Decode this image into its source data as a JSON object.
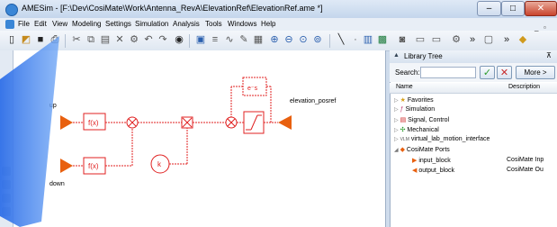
{
  "window": {
    "title": "AMESim - [F:\\Dev\\CosiMate\\Work\\Antenna_RevA\\ElevationRef\\ElevationRef.ame *]",
    "minimize": "–",
    "maximize": "□",
    "close": "✕"
  },
  "menu": {
    "items": [
      "File",
      "Edit",
      "View",
      "Modeling",
      "Settings",
      "Simulation",
      "Analysis",
      "Tools",
      "Windows",
      "Help"
    ]
  },
  "toolbar": {
    "icons": [
      "new-icon",
      "open-icon",
      "save-icon",
      "print-icon",
      "cut-icon",
      "copy-icon",
      "paste-icon",
      "delete-icon",
      "undo-icon",
      "redo-icon",
      "find-icon",
      "zoom-in-icon",
      "zoom-out-icon",
      "zoom-fit-icon",
      "line-icon",
      "grid-icon",
      "more-icon"
    ]
  },
  "diagram": {
    "label_up": "up",
    "label_down": "down",
    "label_output": "elevation_posref",
    "block_fx": "f(x)",
    "block_gain": "k",
    "block_delay": "e⁻s"
  },
  "library": {
    "title": "Library Tree",
    "search_label": "Search:",
    "search_value": "",
    "more_label": "More >",
    "col_name": "Name",
    "col_description": "Description",
    "tree": [
      {
        "label": "Favorites",
        "description": "",
        "expanded": false
      },
      {
        "label": "Simulation",
        "description": "",
        "expanded": false
      },
      {
        "label": "Signal, Control",
        "description": "",
        "expanded": false
      },
      {
        "label": "Mechanical",
        "description": "",
        "expanded": false
      },
      {
        "label": "virtual_lab_motion_interface",
        "description": "",
        "expanded": false
      },
      {
        "label": "CosiMate Ports",
        "description": "",
        "expanded": true
      },
      {
        "label": "input_block",
        "description": "CosiMate Inp",
        "child": true
      },
      {
        "label": "output_block",
        "description": "CosiMate Ou",
        "child": true
      }
    ]
  },
  "colors": {
    "accent": "#e8600f",
    "signal": "#e02020",
    "window_bg": "#cfdcec",
    "overlay_blue": "#3d7df0"
  }
}
